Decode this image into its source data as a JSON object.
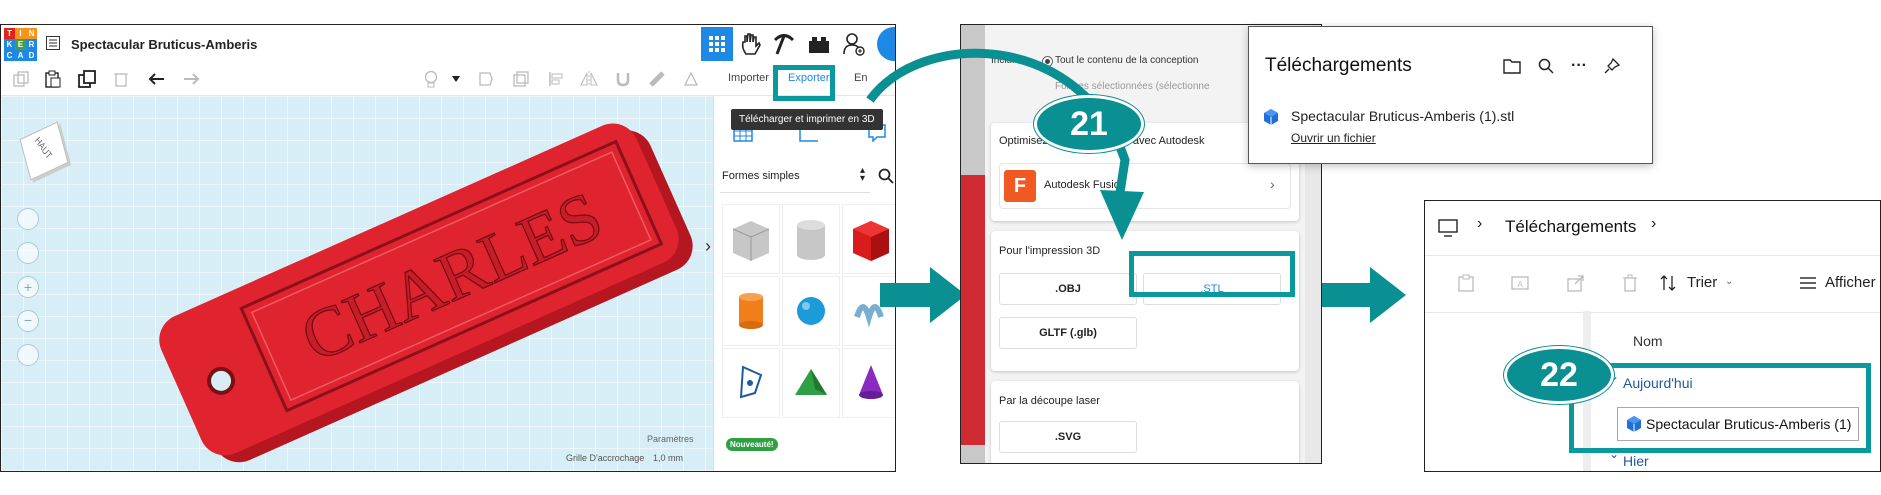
{
  "tinkercad": {
    "logo_letters": [
      "T",
      "I",
      "N",
      "K",
      "E",
      "R",
      "C",
      "A",
      "D"
    ],
    "title": "Spectacular Bruticus-Amberis",
    "toolbar": {
      "import": "Importer",
      "export": "Exporter",
      "send": "En"
    },
    "tooltip": "Télécharger et imprimer en 3D",
    "view_cube_label": "HAUT",
    "shapes_dropdown": "Formes simples",
    "new_badge": "Nouveauté!",
    "params": "Paramètres",
    "grid_label": "Grille D'accrochage",
    "grid_value": "1,0 mm",
    "keychain_text": "CHARLES"
  },
  "export_dialog": {
    "include_label": "Inclure",
    "include_option_all": "Tout le contenu de la conception",
    "include_option_selected": "Formes sélectionnées (sélectionne",
    "optimize_heading": "Optimisez vos conceptions avec Autodesk",
    "fusion_label": "Autodesk Fusion",
    "print_heading": "Pour l'impression 3D",
    "obj": ".OBJ",
    "stl": ".STL",
    "gltf": "GLTF (.glb)",
    "laser_heading": "Par la découpe laser",
    "svg": ".SVG"
  },
  "downloads_popup": {
    "title": "Téléchargements",
    "file_name": "Spectacular Bruticus-Amberis (1).stl",
    "open_link": "Ouvrir un fichier"
  },
  "explorer": {
    "breadcrumb": "Téléchargements",
    "sort": "Trier",
    "view": "Afficher",
    "column_name": "Nom",
    "group_today": "Aujourd'hui",
    "file": "Spectacular Bruticus-Amberis (1)",
    "group_yesterday": "Hier"
  },
  "badges": {
    "step21": "21",
    "step22": "22"
  },
  "colors": {
    "teal": "#0a8f93",
    "keychain_red": "#e0242f",
    "orange": "#f05a22"
  }
}
